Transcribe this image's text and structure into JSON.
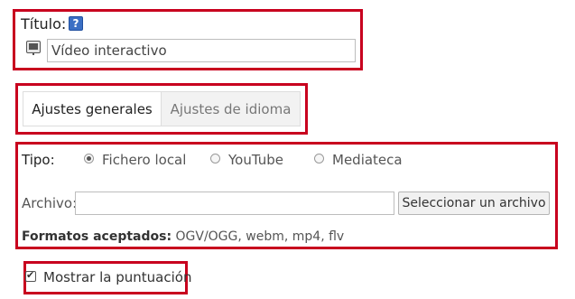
{
  "title_field": {
    "label": "Título:",
    "help_icon": "question-icon",
    "media_icon": "media-screen-icon",
    "value": "Vídeo interactivo"
  },
  "tabs": [
    {
      "label": "Ajustes generales",
      "active": true
    },
    {
      "label": "Ajustes de idioma",
      "active": false
    }
  ],
  "source": {
    "type_label": "Tipo:",
    "options": [
      {
        "label": "Fichero local",
        "checked": true
      },
      {
        "label": "YouTube",
        "checked": false
      },
      {
        "label": "Mediateca",
        "checked": false
      }
    ],
    "file_label": "Archivo:",
    "file_value": "",
    "select_button": "Seleccionar un archivo",
    "formats_label": "Formatos aceptados:",
    "formats_value": "OGV/OGG, webm, mp4, flv"
  },
  "show_score": {
    "label": "Mostrar la puntuación",
    "checked": true
  },
  "colors": {
    "highlight": "#c8001e",
    "help_icon": "#3b6fc4"
  }
}
